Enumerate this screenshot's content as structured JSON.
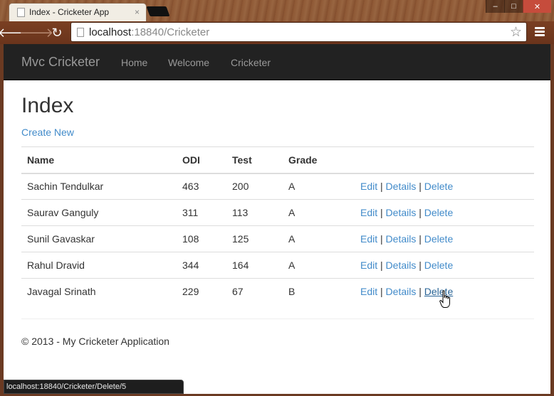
{
  "browser": {
    "tab_title": "Index - Cricketer App",
    "tab_close": "×",
    "url_host": "localhost",
    "url_rest": ":18840/Cricketer",
    "status_url": "localhost:18840/Cricketer/Delete/5"
  },
  "navbar": {
    "brand": "Mvc Cricketer",
    "links": [
      "Home",
      "Welcome",
      "Cricketer"
    ]
  },
  "page": {
    "title": "Index",
    "create_new": "Create New"
  },
  "table": {
    "headers": [
      "Name",
      "ODI",
      "Test",
      "Grade"
    ],
    "rows": [
      {
        "name": "Sachin Tendulkar",
        "odi": "463",
        "test": "200",
        "grade": "A"
      },
      {
        "name": "Saurav Ganguly",
        "odi": "311",
        "test": "113",
        "grade": "A"
      },
      {
        "name": "Sunil Gavaskar",
        "odi": "108",
        "test": "125",
        "grade": "A"
      },
      {
        "name": "Rahul Dravid",
        "odi": "344",
        "test": "164",
        "grade": "A"
      },
      {
        "name": "Javagal Srinath",
        "odi": "229",
        "test": "67",
        "grade": "B"
      }
    ],
    "actions": {
      "edit": "Edit",
      "details": "Details",
      "delete": "Delete",
      "separator": "|"
    }
  },
  "footer": {
    "text": "© 2013 - My Cricketer Application"
  },
  "colors": {
    "link": "#428bca",
    "navbar_bg": "#222222",
    "chrome_bg": "#7a3f22"
  }
}
